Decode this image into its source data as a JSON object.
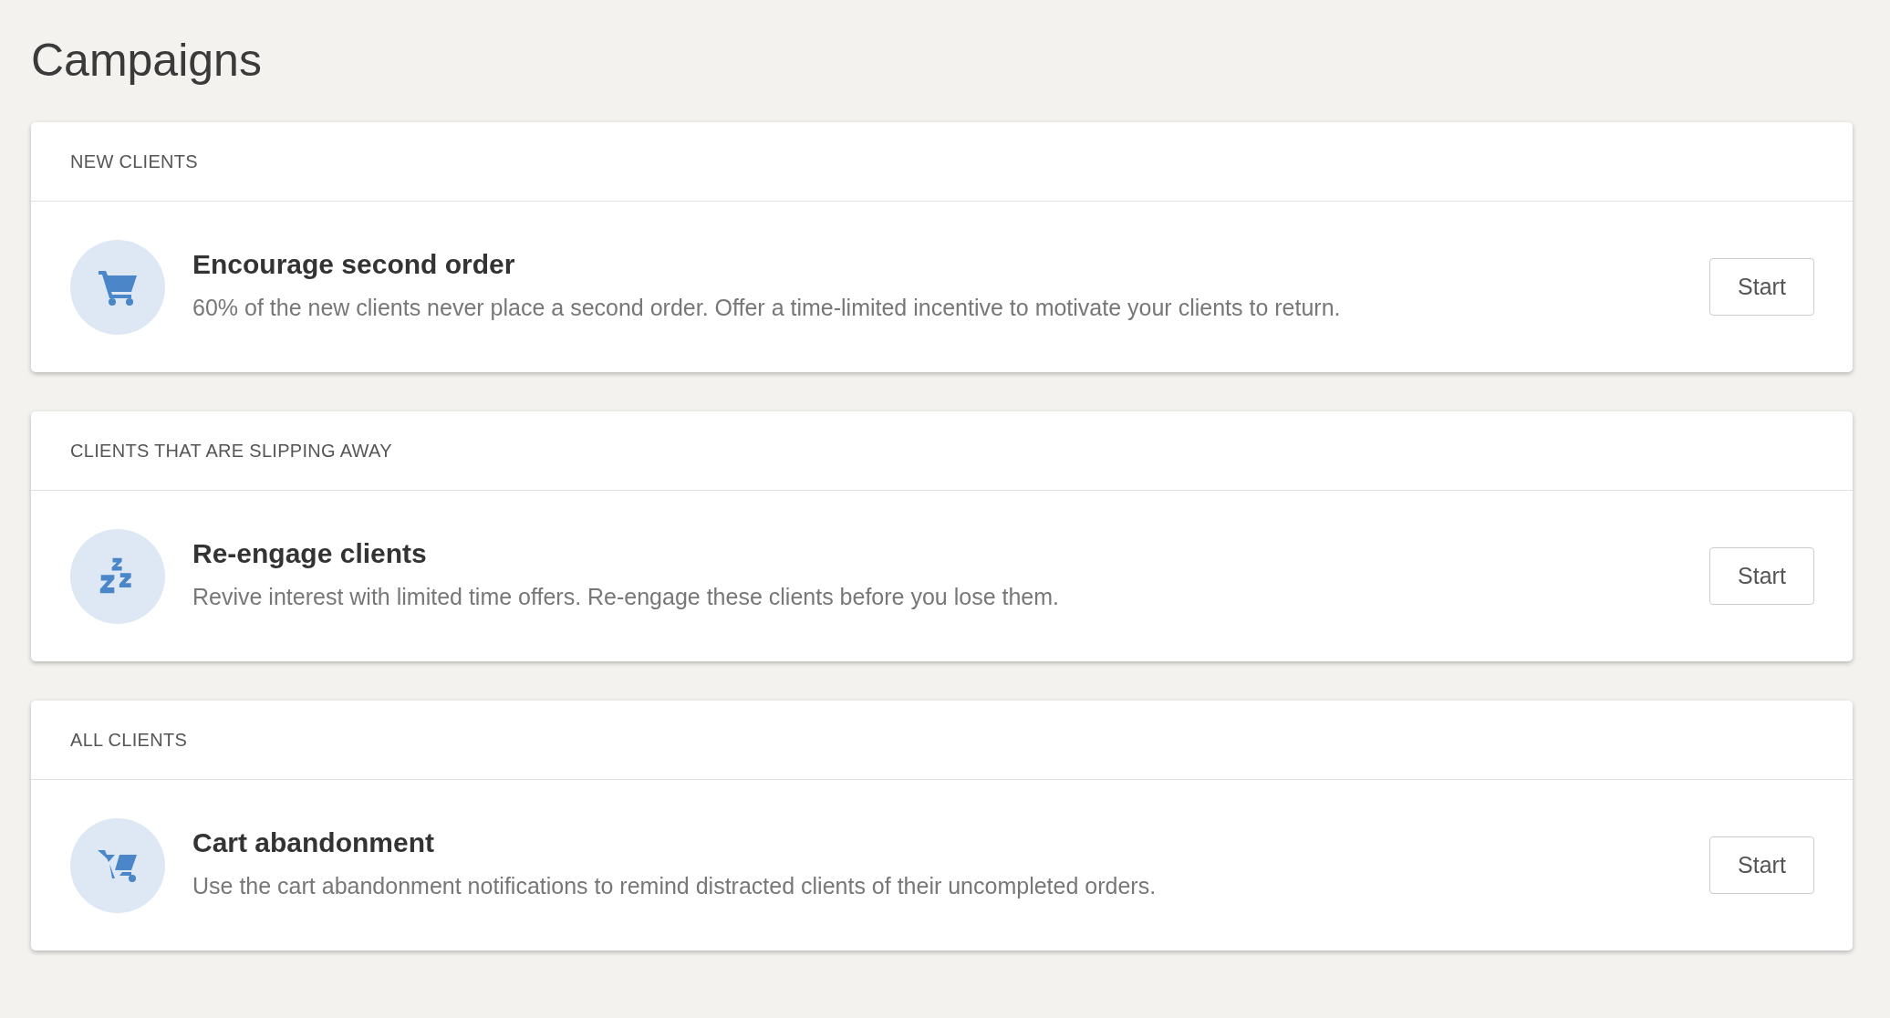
{
  "page_title": "Campaigns",
  "sections": [
    {
      "heading": "NEW CLIENTS",
      "campaigns": [
        {
          "title": "Encourage second order",
          "description": "60% of the new clients never place a second order. Offer a time-limited incentive to motivate your clients to return.",
          "button": "Start"
        }
      ]
    },
    {
      "heading": "CLIENTS THAT ARE SLIPPING AWAY",
      "campaigns": [
        {
          "title": "Re-engage clients",
          "description": "Revive interest with limited time offers. Re-engage these clients before you lose them.",
          "button": "Start"
        }
      ]
    },
    {
      "heading": "ALL CLIENTS",
      "campaigns": [
        {
          "title": "Cart abandonment",
          "description": "Use the cart abandonment notifications to remind distracted clients of their uncompleted orders.",
          "button": "Start"
        }
      ]
    }
  ]
}
